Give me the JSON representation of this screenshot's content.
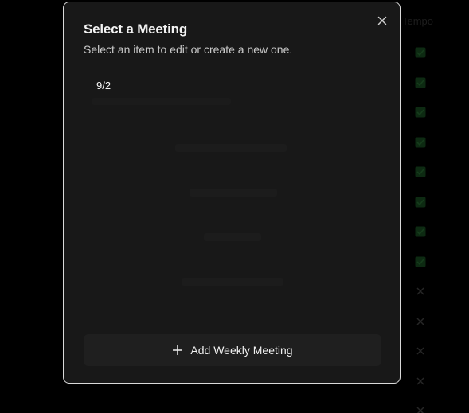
{
  "modal": {
    "title": "Select a Meeting",
    "subtitle": "Select an item to edit or create a new one.",
    "close_icon": "close-icon",
    "meetings": [
      {
        "label": "9/2"
      }
    ],
    "add_button": {
      "label": "Add Weekly Meeting",
      "icon": "plus-icon"
    }
  },
  "background": {
    "column_label": "Tempo",
    "status_marks": [
      "check",
      "check",
      "check",
      "check",
      "check",
      "check",
      "check",
      "check",
      "cross",
      "cross",
      "cross",
      "cross",
      "cross"
    ]
  },
  "colors": {
    "modal_bg": "#181818",
    "modal_border": "#d9d9d9",
    "button_bg": "#1f1f1f",
    "text_primary": "#f2f2f2",
    "text_secondary": "#c9c9c9",
    "bg_check": "#0d2a12",
    "bg_cross": "#262626"
  }
}
